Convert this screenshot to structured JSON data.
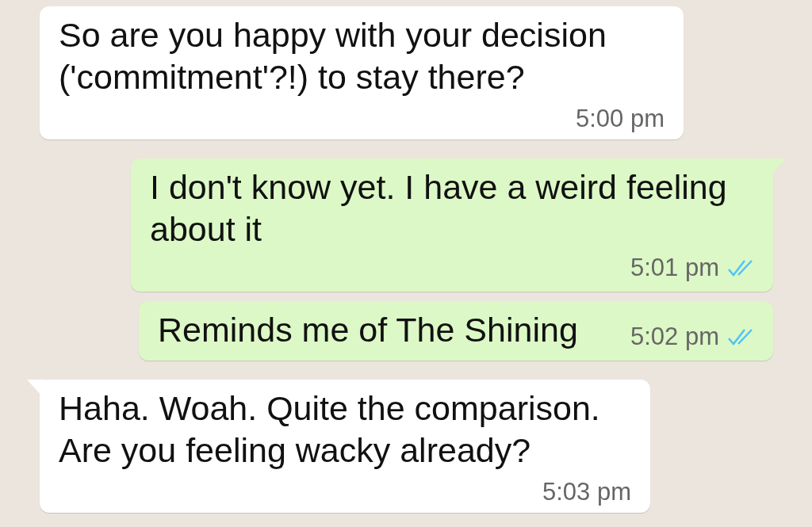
{
  "messages": [
    {
      "kind": "incoming",
      "text": "So are you happy with your decision ('commitment'?!) to stay there?",
      "time": "5:00 pm",
      "tail": false
    },
    {
      "kind": "outgoing",
      "text": "I don't know yet. I have a weird feeling about it",
      "time": "5:01 pm",
      "tail": true,
      "read": true
    },
    {
      "kind": "outgoing",
      "text": "Reminds me of The Shining",
      "time": "5:02 pm",
      "tail": false,
      "read": true
    },
    {
      "kind": "incoming",
      "text": "Haha. Woah. Quite the comparison. Are you feeling wacky already?",
      "time": "5:03 pm",
      "tail": true
    }
  ]
}
